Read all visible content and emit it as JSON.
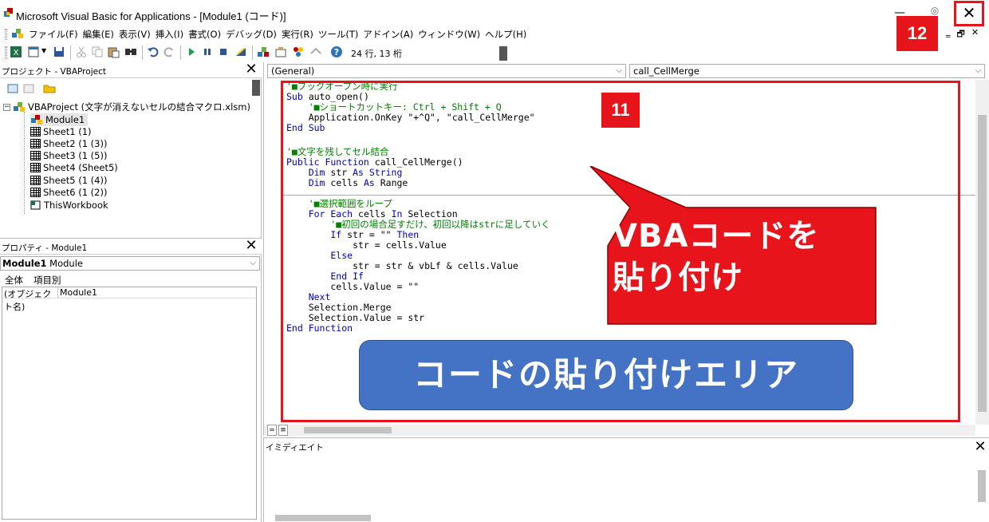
{
  "window": {
    "title": "Microsoft Visual Basic for Applications - [Module1 (コード)]",
    "close_glyph": "✕",
    "minimize_glyph": "—",
    "restore_glyph": "◎"
  },
  "menu": {
    "items": [
      "ファイル(F)",
      "編集(E)",
      "表示(V)",
      "挿入(I)",
      "書式(O)",
      "デバッグ(D)",
      "実行(R)",
      "ツール(T)",
      "アドイン(A)",
      "ウィンドウ(W)",
      "ヘルプ(H)"
    ],
    "mdi_min": "‗",
    "mdi_restore": "🗗",
    "mdi_close": "✕"
  },
  "toolbar": {
    "position_text": "24 行, 13 桁",
    "icons": [
      "excel-icon",
      "insert-module-icon",
      "save-icon",
      "cut-icon",
      "copy-icon",
      "paste-icon",
      "find-icon",
      "undo-icon",
      "redo-icon",
      "run-icon",
      "break-icon",
      "reset-icon",
      "design-mode-icon",
      "project-explorer-icon",
      "properties-icon",
      "object-browser-icon",
      "toolbox-icon",
      "help-icon"
    ]
  },
  "project_pane": {
    "title": "プロジェクト - VBAProject",
    "close_glyph": "✕",
    "root": "VBAProject (文字が消えないセルの結合マクロ.xlsm)",
    "items": [
      "Module1",
      "Sheet1 (1)",
      "Sheet2 (1 (3))",
      "Sheet3 (1 (5))",
      "Sheet4 (Sheet5)",
      "Sheet5 (1 (4))",
      "Sheet6 (1 (2))",
      "ThisWorkbook"
    ]
  },
  "props_pane": {
    "title": "プロパティ - Module1",
    "close_glyph": "✕",
    "object_name": "Module1",
    "object_type": "Module",
    "tab_all": "全体",
    "tab_category": "項目別",
    "row_key": "(オブジェクト名)",
    "row_value": "Module1"
  },
  "code_window": {
    "object_combo": "(General)",
    "proc_combo": "call_CellMerge",
    "lines": [
      [
        [
          "cm",
          "'■ブックオープン時に実行"
        ]
      ],
      [
        [
          "kw",
          "Sub"
        ],
        [
          "pl",
          " auto_open()"
        ]
      ],
      [
        [
          "cm",
          "    '■ショートカットキー: Ctrl + Shift + Q"
        ]
      ],
      [
        [
          "pl",
          "    Application.OnKey \"+^Q\", \"call_CellMerge\""
        ]
      ],
      [
        [
          "kw",
          "End Sub"
        ]
      ],
      [
        [
          "pl",
          ""
        ]
      ],
      [
        [
          "cm",
          "'■文字を残してセル結合"
        ]
      ],
      [
        [
          "kw",
          "Public Function"
        ],
        [
          "pl",
          " call_CellMerge()"
        ]
      ],
      [
        [
          "kw",
          "    Dim"
        ],
        [
          "pl",
          " str "
        ],
        [
          "kw",
          "As String"
        ]
      ],
      [
        [
          "kw",
          "    Dim"
        ],
        [
          "pl",
          " cells "
        ],
        [
          "kw",
          "As"
        ],
        [
          "pl",
          " Range"
        ]
      ],
      [
        [
          "pl",
          ""
        ]
      ],
      [
        [
          "cm",
          "    '■選択範囲をループ"
        ]
      ],
      [
        [
          "kw",
          "    For Each"
        ],
        [
          "pl",
          " cells "
        ],
        [
          "kw",
          "In"
        ],
        [
          "pl",
          " Selection"
        ]
      ],
      [
        [
          "cm",
          "        '■初回の場合足すだけ、初回以降はstrに足していく"
        ]
      ],
      [
        [
          "kw",
          "        If"
        ],
        [
          "pl",
          " str = \"\" "
        ],
        [
          "kw",
          "Then"
        ]
      ],
      [
        [
          "pl",
          "            str = cells.Value"
        ]
      ],
      [
        [
          "kw",
          "        Else"
        ]
      ],
      [
        [
          "pl",
          "            str = str & vbLf & cells.Value"
        ]
      ],
      [
        [
          "kw",
          "        End If"
        ]
      ],
      [
        [
          "pl",
          "        cells.Value = \"\""
        ]
      ],
      [
        [
          "kw",
          "    Next"
        ]
      ],
      [
        [
          "pl",
          "    Selection.Merge"
        ]
      ],
      [
        [
          "pl",
          "    Selection.Value = str"
        ]
      ],
      [
        [
          "kw",
          "End Function"
        ]
      ]
    ]
  },
  "annotations": {
    "badge_11": "11",
    "badge_12": "12",
    "callout_line1": "VBAコードを",
    "callout_line2": "貼り付け",
    "paste_area_label": "コードの貼り付けエリア",
    "accent_red": "#e8141b",
    "accent_blue": "#4472c4"
  },
  "immediate": {
    "title": "イミディエイト",
    "close_glyph": "✕"
  }
}
